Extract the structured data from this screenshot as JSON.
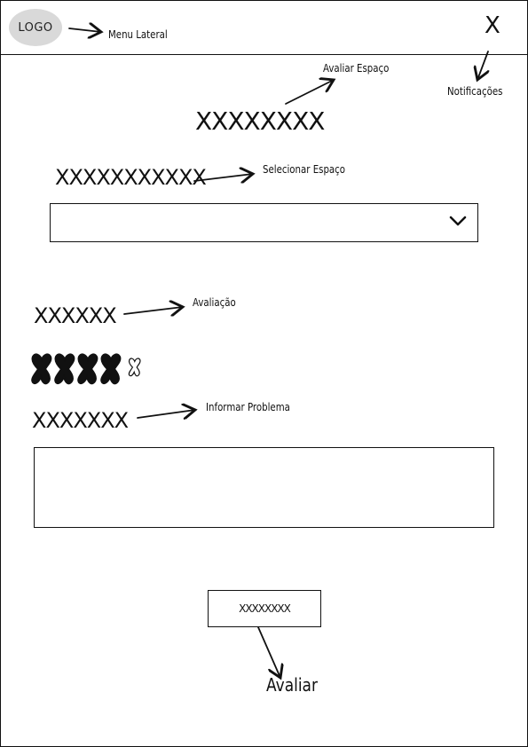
{
  "header": {
    "logo": "LOGO",
    "menu_note": "Menu Lateral",
    "notification_glyph": "X",
    "notification_note": "Notificações"
  },
  "main": {
    "title": "XXXXXXXX",
    "title_note": "Avaliar Espaço",
    "select_label": "XXXXXXXXXXX",
    "select_note": "Selecionar Espaço",
    "rating_label": "XXXXXX",
    "rating_note": "Avaliação",
    "rating": {
      "filled": 4,
      "total": 5
    },
    "problem_label": "XXXXXXX",
    "problem_note": "Informar Problema",
    "submit_label": "XXXXXXXX",
    "submit_note": "Avaliar"
  },
  "icons": {
    "select": "chevron-down-icon",
    "star": "star-icon"
  },
  "colors": {
    "ink": "#111111",
    "logo_bg": "#d9d9d9"
  }
}
